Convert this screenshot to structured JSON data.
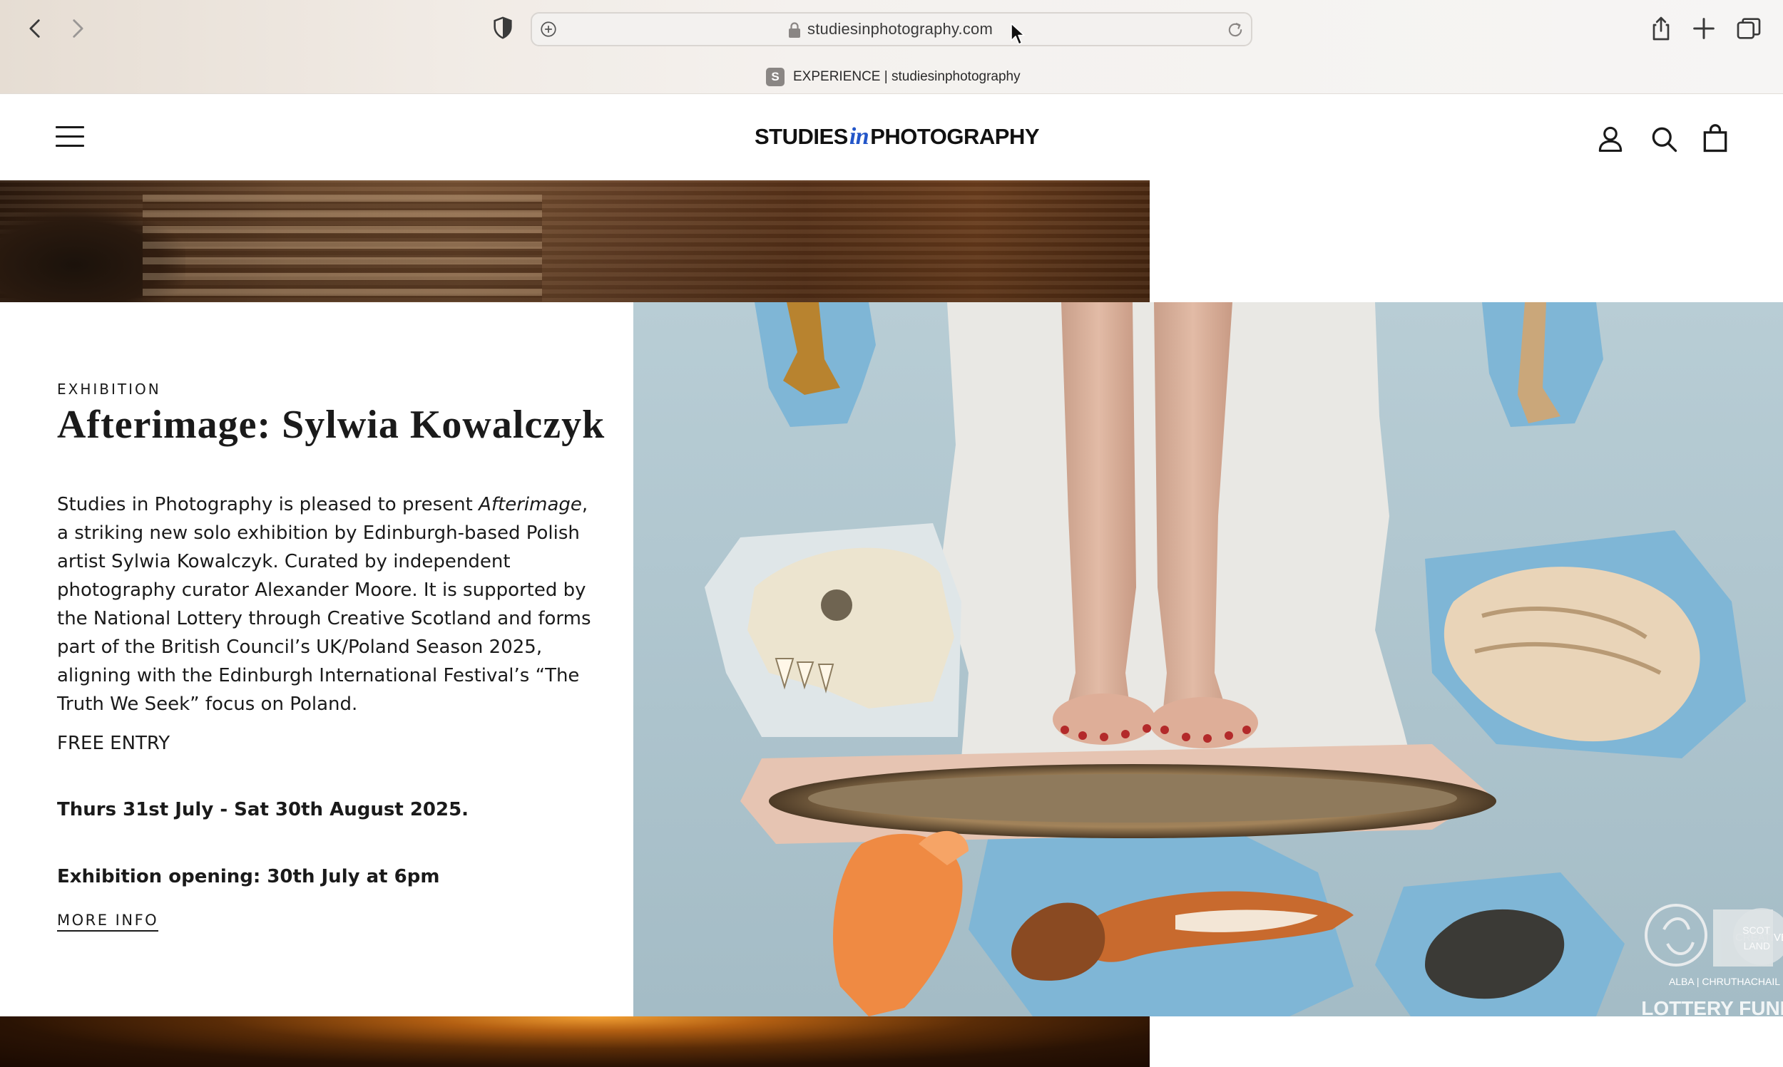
{
  "browser": {
    "url": "studiesinphotography.com",
    "tab_title": "EXPERIENCE | studiesinphotography",
    "tab_favicon_letter": "S",
    "icons": [
      "back-icon",
      "forward-icon",
      "privacy-shield-icon",
      "add-page-icon",
      "lock-icon",
      "reload-icon",
      "share-icon",
      "new-tab-icon",
      "tab-overview-icon"
    ]
  },
  "site": {
    "logo_left": "STUDIES",
    "logo_in": "in",
    "logo_right": "PHOTOGRAPHY",
    "header_icons": [
      "menu-icon",
      "account-icon",
      "search-icon",
      "cart-icon"
    ]
  },
  "exhibition": {
    "eyebrow": "EXHIBITION",
    "title": "Afterimage: Sylwia Kowalczyk",
    "desc_before": "Studies in Photography is pleased to present ",
    "desc_italic": "Afterimage",
    "desc_after": ", a striking new solo exhibition by Edinburgh-based Polish artist Sylwia Kowalczyk. Curated by independent photography curator Alexander Moore. It is supported by the National Lottery through Creative Scotland and forms part of the British Council’s UK/Poland Season 2025, aligning with the Edinburgh International Festival’s “The Truth We Seek” focus on Poland.",
    "free_entry": "FREE ENTRY",
    "dates": "Thurs 31st July - Sat 30th August 2025.",
    "opening": "Exhibition opening: 30th July at 6pm",
    "more_info": "MORE INFO"
  },
  "hero_logos": {
    "creative": "CREATIVE",
    "scotland": "SCOT LAND",
    "alba": "ALBA | CHRUTHACHAIL",
    "lottery": "LOTTERY FUNDED"
  },
  "colors": {
    "accent_logo_in": "#2255c8",
    "text": "#1a1a1a",
    "hero_background": "#abc4ce"
  }
}
